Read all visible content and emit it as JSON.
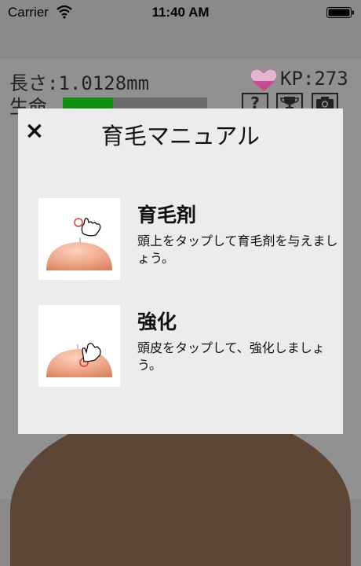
{
  "status_bar": {
    "carrier": "Carrier",
    "time": "11:40 AM"
  },
  "game_header": {
    "length_text": "長さ:1.0128mm",
    "kp_text": "KP:273",
    "life_label": "生命",
    "life_fraction": 0.35,
    "icons": [
      "help-icon",
      "trophy-icon",
      "camera-icon"
    ],
    "help_symbol": "?"
  },
  "modal": {
    "close_symbol": "×",
    "title": "育毛マニュアル",
    "items": [
      {
        "title": "育毛剤",
        "description": "頭上をタップして育毛剤を与えましょう。",
        "image": "scalp-tap-above-illustration"
      },
      {
        "title": "強化",
        "description": "頭皮をタップして、強化しましょう。",
        "image": "scalp-tap-skin-illustration"
      }
    ]
  },
  "colors": {
    "overlay_gray": "#8a8a8a",
    "modal_bg": "#ececec",
    "life_green": "#108f10",
    "heart_pink": "#d45a9a",
    "skin": "#e89a7a",
    "tap_red": "#e0403a"
  }
}
